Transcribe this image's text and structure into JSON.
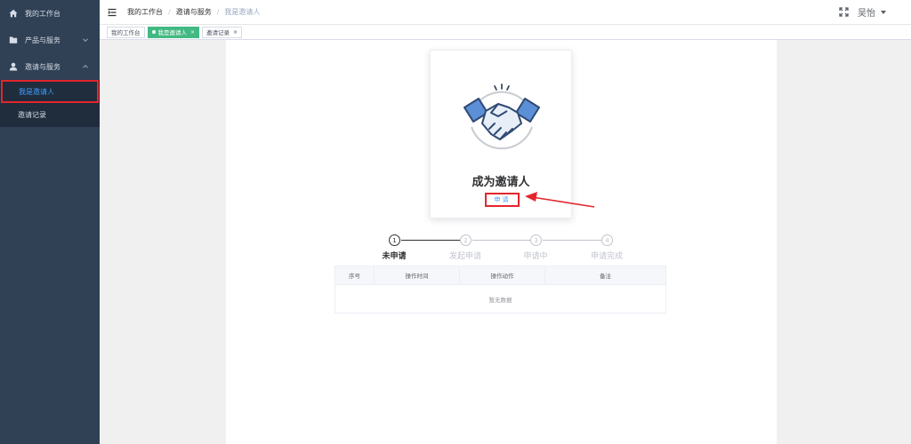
{
  "sidebar": {
    "items": [
      {
        "label": "我的工作台",
        "icon": "home-icon"
      },
      {
        "label": "产品与服务",
        "icon": "folder-icon"
      },
      {
        "label": "邀请与服务",
        "icon": "user-icon"
      }
    ],
    "submenu": [
      {
        "label": "我是邀请人",
        "active": true
      },
      {
        "label": "邀请记录",
        "active": false
      }
    ]
  },
  "header": {
    "breadcrumb": [
      "我的工作台",
      "邀请与服务",
      "我是邀请人"
    ],
    "username": "吴怡"
  },
  "tags": [
    {
      "label": "我的工作台",
      "active": false
    },
    {
      "label": "我是邀请人",
      "active": true
    },
    {
      "label": "邀请记录",
      "active": false
    }
  ],
  "card": {
    "title": "成为邀请人",
    "apply_label": "申请"
  },
  "steps": [
    {
      "num": "1",
      "label": "未申请",
      "done": true
    },
    {
      "num": "2",
      "label": "发起申请",
      "done": false
    },
    {
      "num": "3",
      "label": "申请中",
      "done": false
    },
    {
      "num": "4",
      "label": "申请完成",
      "done": false
    }
  ],
  "table": {
    "columns": [
      "序号",
      "操作时间",
      "操作动作",
      "备注"
    ],
    "empty_text": "暂无数据"
  },
  "colors": {
    "sidebar_bg": "#304156",
    "accent": "#409eff",
    "tag_active": "#42b983",
    "highlight": "#e3262c"
  }
}
